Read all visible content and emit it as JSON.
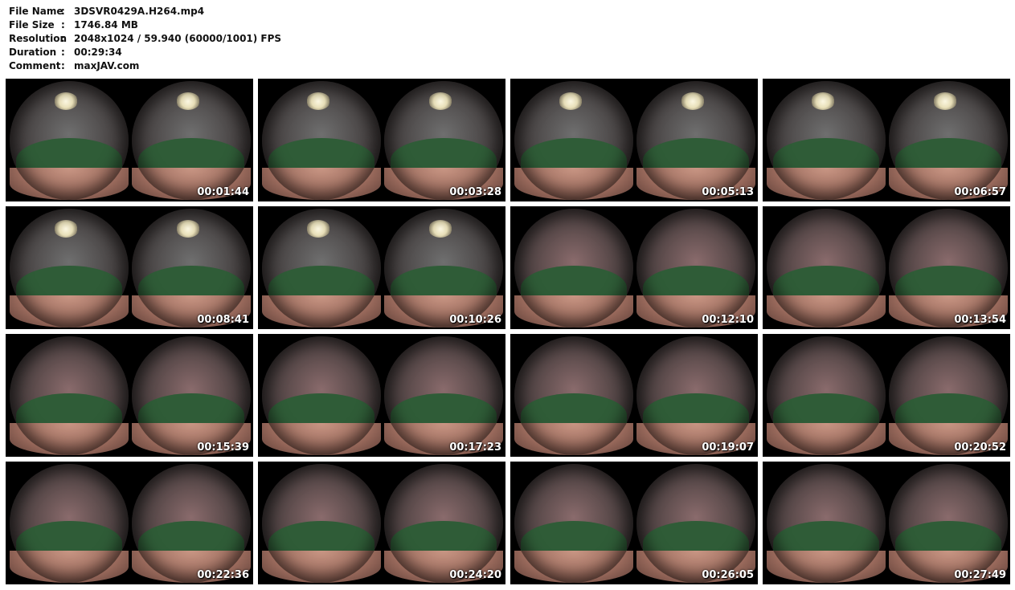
{
  "info": {
    "rows": [
      {
        "label": "File Name",
        "sep": ":",
        "value": "3DSVR0429A.H264.mp4"
      },
      {
        "label": "File Size",
        "sep": ":",
        "value": "1746.84 MB"
      },
      {
        "label": "Resolution",
        "sep": ":",
        "value": "2048x1024 / 59.940 (60000/1001) FPS"
      },
      {
        "label": "Duration",
        "sep": ":",
        "value": "00:29:34"
      },
      {
        "label": "Comment",
        "sep": ":",
        "value": "maxJAV.com"
      }
    ]
  },
  "thumbnails": [
    {
      "time": "00:01:44",
      "scene": "surgery",
      "lamp": true
    },
    {
      "time": "00:03:28",
      "scene": "surgery",
      "lamp": true
    },
    {
      "time": "00:05:13",
      "scene": "surgery",
      "lamp": true
    },
    {
      "time": "00:06:57",
      "scene": "surgery",
      "lamp": true
    },
    {
      "time": "00:08:41",
      "scene": "surgery",
      "lamp": true
    },
    {
      "time": "00:10:26",
      "scene": "surgery",
      "lamp": true
    },
    {
      "time": "00:12:10",
      "scene": "pink",
      "lamp": false
    },
    {
      "time": "00:13:54",
      "scene": "pink",
      "lamp": false
    },
    {
      "time": "00:15:39",
      "scene": "pink",
      "lamp": false
    },
    {
      "time": "00:17:23",
      "scene": "pink",
      "lamp": false
    },
    {
      "time": "00:19:07",
      "scene": "pink",
      "lamp": false
    },
    {
      "time": "00:20:52",
      "scene": "pink",
      "lamp": false
    },
    {
      "time": "00:22:36",
      "scene": "pink",
      "lamp": false
    },
    {
      "time": "00:24:20",
      "scene": "pink",
      "lamp": false
    },
    {
      "time": "00:26:05",
      "scene": "pink",
      "lamp": false
    },
    {
      "time": "00:27:49",
      "scene": "pink",
      "lamp": false
    }
  ],
  "colors": {
    "surgery_bg": "#6f6f6f",
    "pink_bg": "#8a6b6c",
    "sheet": "#2f5c37",
    "timestamp": "#ffffff"
  }
}
